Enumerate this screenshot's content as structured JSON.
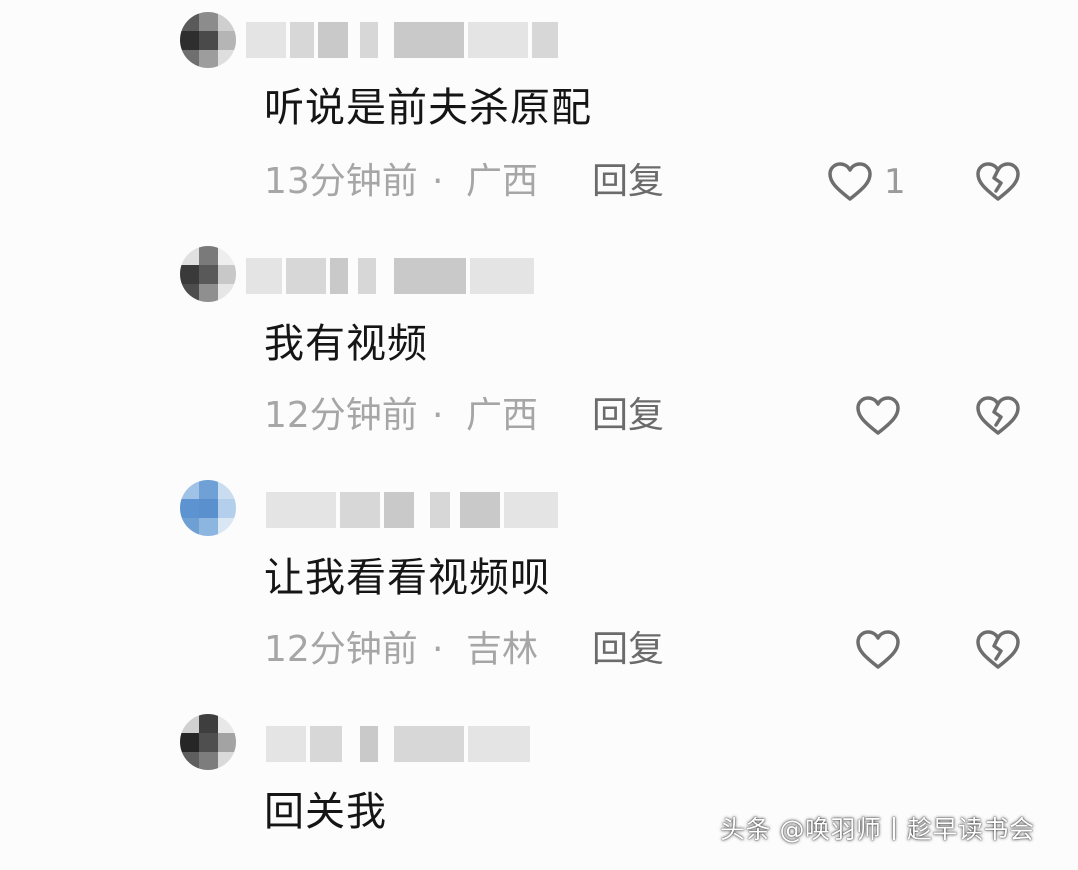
{
  "comments": [
    {
      "text": "听说是前夫杀原配",
      "time": "13分钟前",
      "dot": "·",
      "location": "广西",
      "reply_label": "回复",
      "like_count": "1",
      "avatar_style": "dark"
    },
    {
      "text": "我有视频",
      "time": "12分钟前",
      "dot": "·",
      "location": "广西",
      "reply_label": "回复",
      "like_count": "",
      "avatar_style": "dark"
    },
    {
      "text": "让我看看视频呗",
      "time": "12分钟前",
      "dot": "·",
      "location": "吉林",
      "reply_label": "回复",
      "like_count": "",
      "avatar_style": "blue"
    },
    {
      "text": "回关我",
      "time": "",
      "dot": "",
      "location": "",
      "reply_label": "",
      "like_count": "",
      "avatar_style": "dark"
    }
  ],
  "icons": {
    "like": "heart-outline-icon",
    "dislike": "broken-heart-icon"
  },
  "colors": {
    "meta_text": "#a6a6a6",
    "reply_text": "#6b6b6b",
    "icon_stroke": "#6e6e6e"
  },
  "watermark": "头条 @唤羽师丨趁早读书会"
}
